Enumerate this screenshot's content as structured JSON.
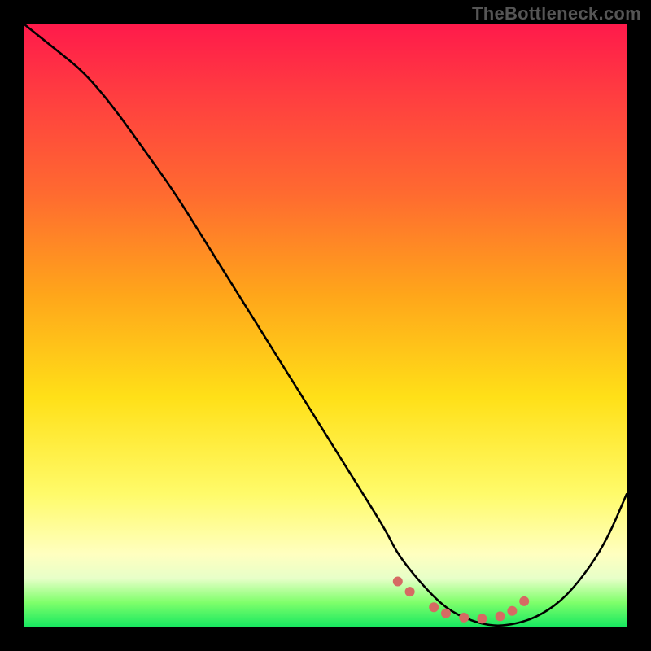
{
  "watermark": "TheBottleneck.com",
  "chart_data": {
    "type": "line",
    "title": "",
    "xlabel": "",
    "ylabel": "",
    "xlim": [
      0,
      100
    ],
    "ylim": [
      0,
      100
    ],
    "grid": false,
    "gradient_background": true,
    "gradient_stops": [
      {
        "pos": 0,
        "color": "#ff1a4b"
      },
      {
        "pos": 12,
        "color": "#ff3e40"
      },
      {
        "pos": 28,
        "color": "#ff6a30"
      },
      {
        "pos": 45,
        "color": "#ffa61a"
      },
      {
        "pos": 62,
        "color": "#ffe018"
      },
      {
        "pos": 78,
        "color": "#fffb6a"
      },
      {
        "pos": 88,
        "color": "#ffffc0"
      },
      {
        "pos": 92,
        "color": "#e7ffc8"
      },
      {
        "pos": 96,
        "color": "#7fff6b"
      },
      {
        "pos": 100,
        "color": "#18e860"
      }
    ],
    "series": [
      {
        "name": "bottleneck-curve",
        "color": "#000000",
        "x": [
          0,
          5,
          10,
          15,
          20,
          25,
          30,
          35,
          40,
          45,
          50,
          55,
          60,
          62,
          66,
          70,
          74,
          78,
          82,
          86,
          90,
          94,
          97,
          100
        ],
        "values": [
          100,
          96,
          92,
          86,
          79,
          72,
          64,
          56,
          48,
          40,
          32,
          24,
          16,
          12,
          7,
          3,
          1,
          0,
          0.5,
          2,
          5,
          10,
          15,
          22
        ]
      }
    ],
    "markers": {
      "name": "optimal-range-dots",
      "color": "#d66a63",
      "x": [
        62,
        64,
        68,
        70,
        73,
        76,
        79,
        81,
        83
      ],
      "y": [
        7.5,
        5.8,
        3.2,
        2.2,
        1.5,
        1.3,
        1.7,
        2.6,
        4.2
      ]
    }
  }
}
